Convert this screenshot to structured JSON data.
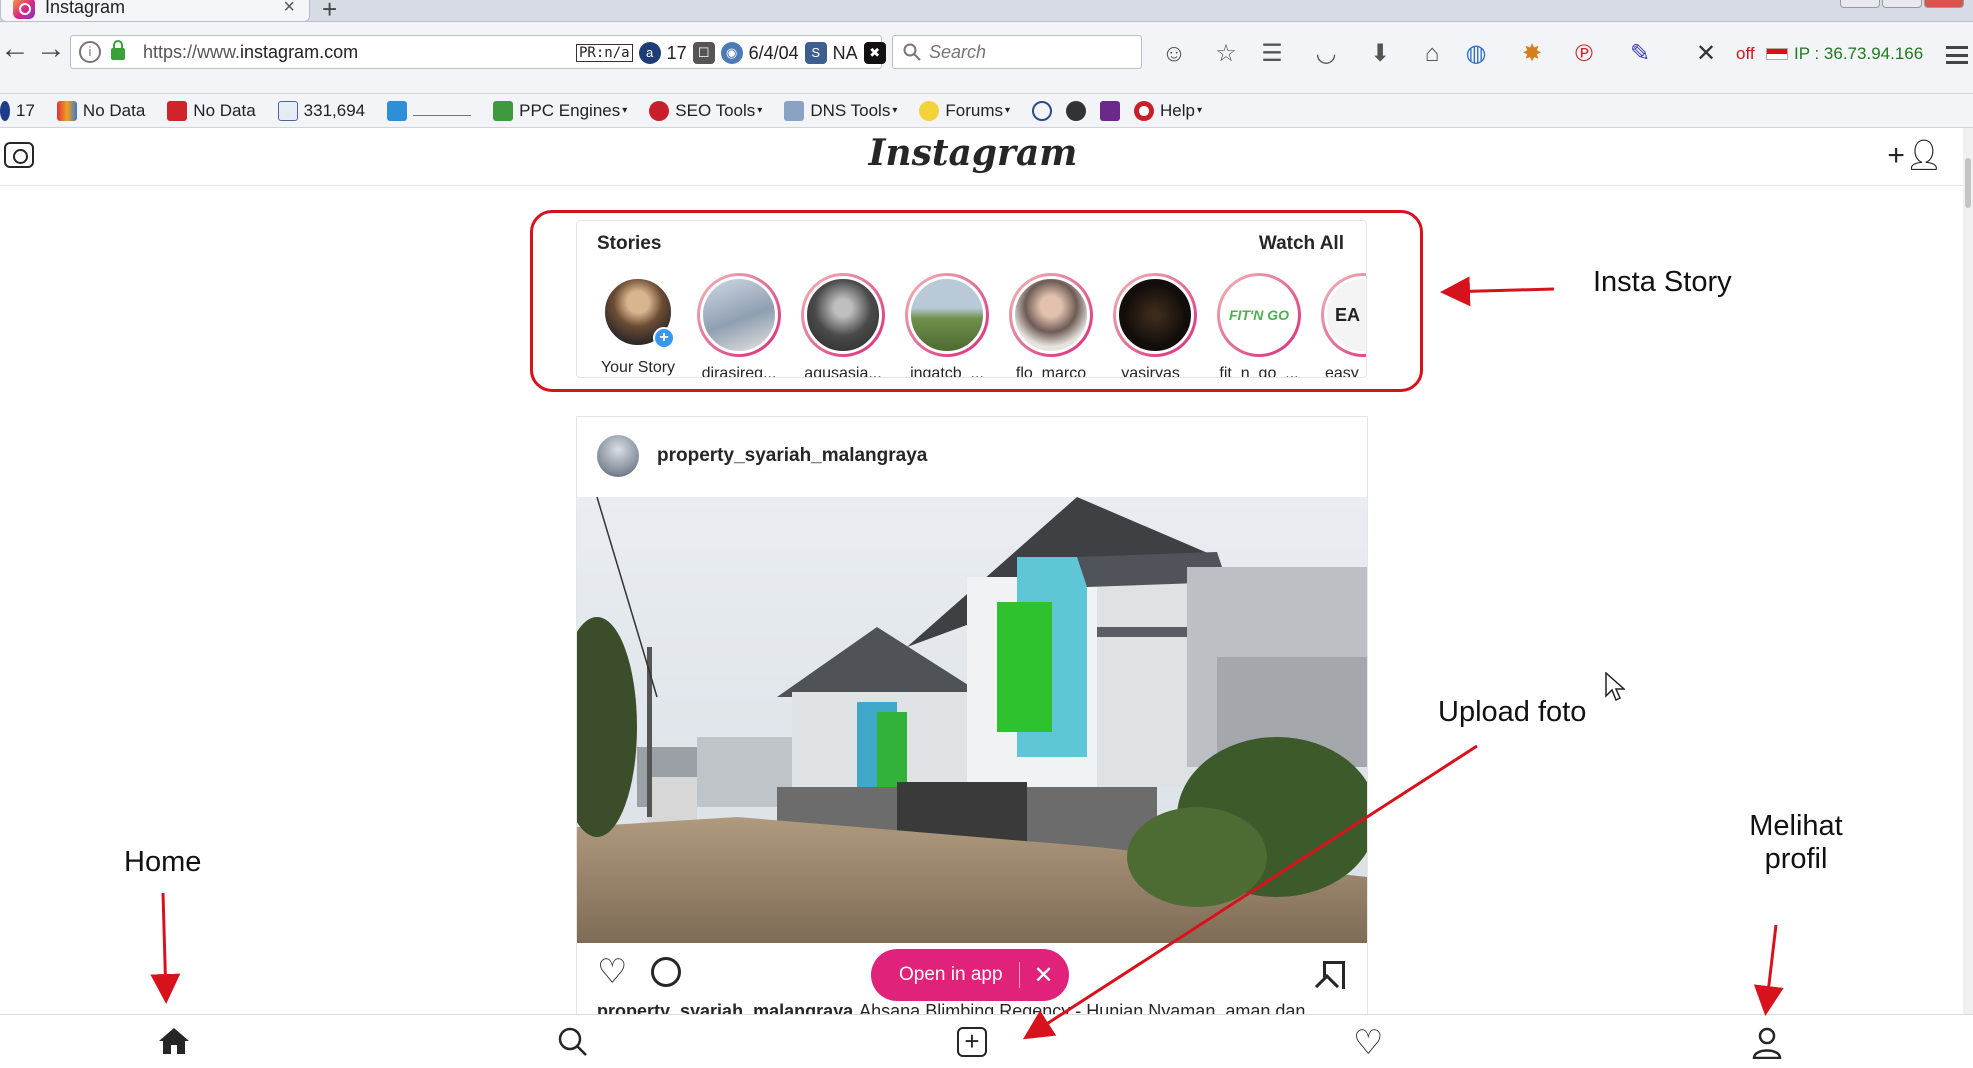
{
  "browser": {
    "tab_title": "Instagram",
    "tab_close": "×",
    "new_tab": "+",
    "url_prefix": "https://www.",
    "url_domain": "instagram.com",
    "pr_label": "PR:n/a",
    "alexa_count": "17",
    "date_text": "6/4/04",
    "na_text": "NA",
    "search_placeholder": "Search",
    "off_label": "off",
    "ip_text": "IP : 36.73.94.166"
  },
  "bookmarks": {
    "items": [
      {
        "label": "17",
        "icon": "blue-dot-icon"
      },
      {
        "label": "No Data",
        "icon": "people-icon"
      },
      {
        "label": "No Data",
        "icon": "flag-icon"
      },
      {
        "label": "331,694",
        "icon": "bar-chart-icon"
      },
      {
        "label": "",
        "icon": "mail-icon"
      },
      {
        "label": "PPC Engines",
        "icon": "money-icon"
      },
      {
        "label": "SEO Tools",
        "icon": "bug-icon"
      },
      {
        "label": "DNS Tools",
        "icon": "wrench-icon"
      },
      {
        "label": "Forums",
        "icon": "smiley-icon"
      },
      {
        "label": "Help",
        "icon": "lifebuoy-icon"
      }
    ]
  },
  "header": {
    "logo": "Instagram"
  },
  "stories": {
    "title": "Stories",
    "watch_all": "Watch All",
    "items": [
      {
        "name": "Your Story",
        "color": "#8a6a4c"
      },
      {
        "name": "dirasireg...",
        "color": "#9aa7b5"
      },
      {
        "name": "agusasia...",
        "color": "#4a4a4a"
      },
      {
        "name": "ingatcb_...",
        "color": "#7e9a5e"
      },
      {
        "name": "flo_marco",
        "color": "#8b7b74"
      },
      {
        "name": "yasiryas_",
        "color": "#1a1410"
      },
      {
        "name": "fit_n_go_...",
        "color": "#ffffff"
      },
      {
        "name": "easy",
        "color": "#f4f4f4"
      }
    ]
  },
  "post": {
    "username": "property_syariah_malangraya",
    "caption_user": "property_syariah_malangraya",
    "caption_text": "Ahsana Blimbing Regency - Hunian Nyaman, aman dan"
  },
  "open_app": {
    "label": "Open in app",
    "close": "✕"
  },
  "annotations": {
    "insta_story": "Insta Story",
    "upload_foto": "Upload foto",
    "home": "Home",
    "melihat_profil_line1": "Melihat",
    "melihat_profil_line2": "profil"
  },
  "colors": {
    "annotation_red": "#d8121c",
    "open_app_pink": "#e0227b",
    "story_blue": "#3897f0"
  }
}
